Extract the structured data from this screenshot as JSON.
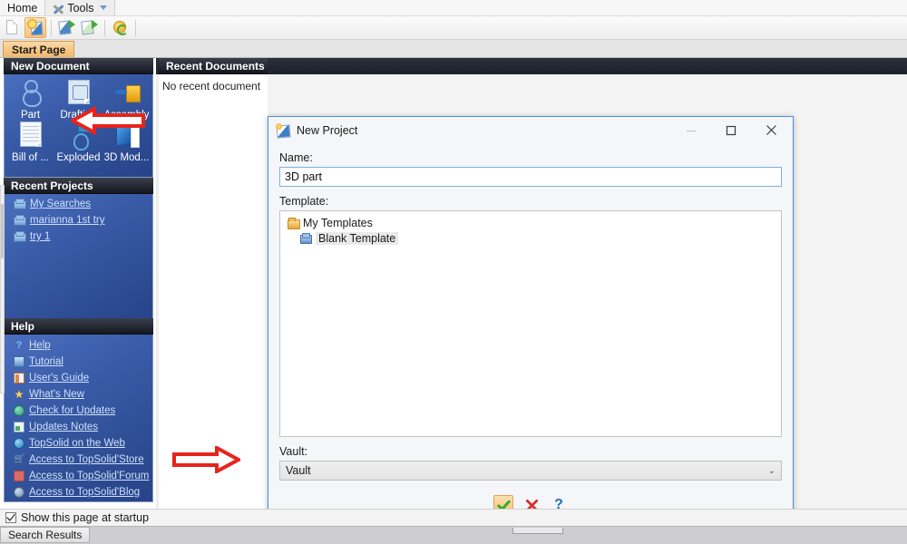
{
  "menubar": {
    "home_label": "Home",
    "tools_label": "Tools",
    "tools_icon": "wrench-screwdriver-icon",
    "caret_icon": "chevron-down-icon"
  },
  "toolbar": {
    "buttons": [
      {
        "name": "new-document-button",
        "icon": "blank-page-icon"
      },
      {
        "name": "new-project-button",
        "icon": "sun-blue-page-icon",
        "highlighted": true
      },
      {
        "name": "open-document-button",
        "icon": "open-blue-page-icon"
      },
      {
        "name": "open-project-button",
        "icon": "open-green-page-icon"
      },
      {
        "name": "refresh-button",
        "icon": "recycle-icon"
      }
    ]
  },
  "tabstrip": {
    "start_page_label": "Start Page"
  },
  "new_document": {
    "header": "New Document",
    "items": [
      {
        "label": "Part",
        "icon": "part-icon"
      },
      {
        "label": "Drafting",
        "icon": "drafting-icon"
      },
      {
        "label": "Assembly",
        "icon": "assembly-icon"
      },
      {
        "label": "Bill of ...",
        "icon": "bill-of-materials-icon"
      },
      {
        "label": "Exploded",
        "icon": "exploded-view-icon"
      },
      {
        "label": "3D Mod...",
        "icon": "3d-model-icon"
      }
    ]
  },
  "recent_projects": {
    "header": "Recent Projects",
    "items": [
      {
        "label": "My Searches",
        "icon": "project-icon"
      },
      {
        "label": "marianna 1st try",
        "icon": "project-icon"
      },
      {
        "label": "try 1",
        "icon": "project-icon"
      }
    ]
  },
  "help": {
    "header": "Help",
    "items": [
      {
        "label": "Help",
        "icon": "question-mark-icon"
      },
      {
        "label": "Tutorial",
        "icon": "tutorial-icon"
      },
      {
        "label": "User's Guide",
        "icon": "book-icon"
      },
      {
        "label": "What's New",
        "icon": "star-icon"
      },
      {
        "label": "Check for Updates",
        "icon": "globe-refresh-icon"
      },
      {
        "label": "Updates Notes",
        "icon": "notes-icon"
      },
      {
        "label": "TopSolid on the Web",
        "icon": "web-globe-icon"
      },
      {
        "label": "Access to TopSolid'Store",
        "icon": "shopping-cart-icon"
      },
      {
        "label": "Access to TopSolid'Forum",
        "icon": "forum-icon"
      },
      {
        "label": "Access to TopSolid'Blog",
        "icon": "blog-icon"
      }
    ]
  },
  "recent_documents": {
    "header": "Recent Documents",
    "empty_text": "No recent document"
  },
  "dialog": {
    "title": "New Project",
    "title_icon": "new-project-icon",
    "window_controls": {
      "minimize_icon": "minimize-icon",
      "maximize_icon": "maximize-icon",
      "close_icon": "close-icon"
    },
    "name_label": "Name:",
    "name_value": "3D part",
    "template_label": "Template:",
    "template_tree": [
      {
        "label": "My Templates",
        "icon": "folder-icon",
        "level": 0,
        "selected": false
      },
      {
        "label": "Blank Template",
        "icon": "template-icon",
        "level": 1,
        "selected": true
      }
    ],
    "vault_label": "Vault:",
    "vault_value": "Vault",
    "vault_caret_icon": "chevron-down-icon",
    "actions": [
      {
        "name": "ok-button",
        "icon": "green-check-icon",
        "highlighted": true
      },
      {
        "name": "cancel-button",
        "icon": "red-x-icon",
        "highlighted": false
      },
      {
        "name": "help-button",
        "icon": "blue-question-icon",
        "highlighted": false
      }
    ]
  },
  "startup": {
    "checkbox_checked": true,
    "label": "Show this page at startup"
  },
  "statusbar": {
    "search_results_label": "Search Results"
  },
  "annotations": [
    {
      "name": "name-field-arrow",
      "points_to": "name-input",
      "color": "#e8231c"
    },
    {
      "name": "ok-button-arrow",
      "points_to": "ok-button",
      "color": "#e8231c"
    }
  ],
  "colors": {
    "accent_orange": "#f2b76a",
    "panel_blue": "#3a5ca8",
    "panel_header_dark": "#14171f",
    "annotation_red": "#e8231c",
    "dialog_border_blue": "#4a90d9"
  }
}
